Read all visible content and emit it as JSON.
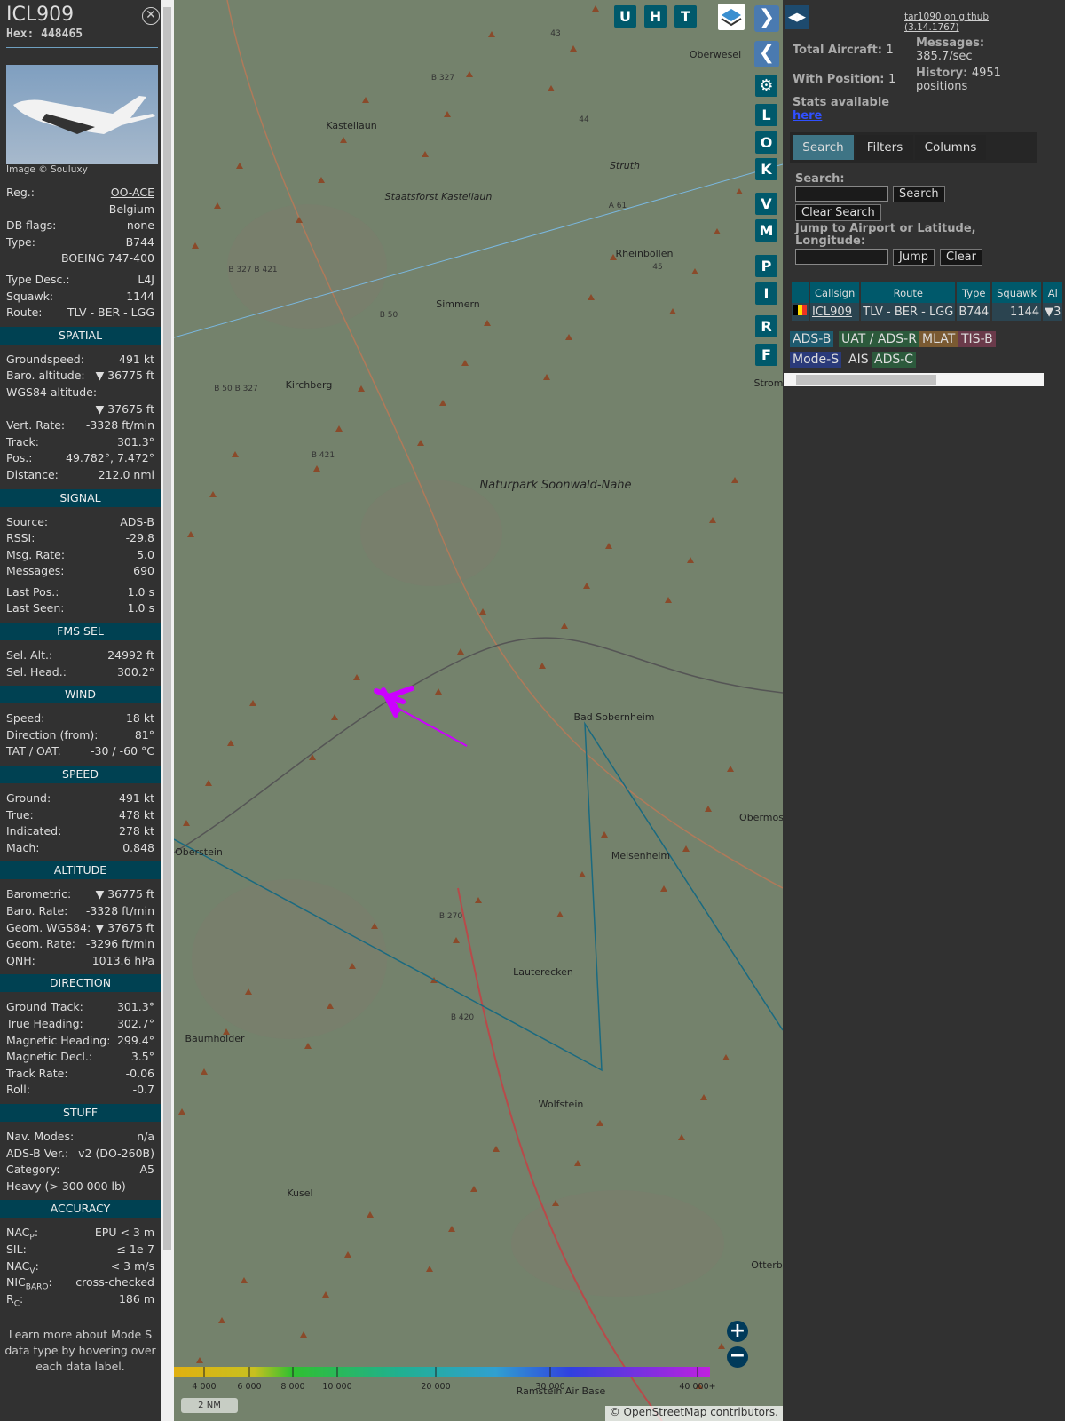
{
  "aircraft": {
    "callsign": "ICL909",
    "hex_label": "Hex:",
    "hex": "448465",
    "photo_credit": "Image © Souluxy"
  },
  "rows": [
    {
      "l": "Reg.:",
      "v": "OO-ACE",
      "link": true
    },
    {
      "l": "",
      "v": "Belgium"
    },
    {
      "l": "DB flags:",
      "v": "none"
    },
    {
      "l": "Type:",
      "v": "B744"
    },
    {
      "l": "",
      "v": "BOEING 747-400"
    },
    {
      "gap": true
    },
    {
      "l": "Type Desc.:",
      "v": "L4J"
    },
    {
      "l": "Squawk:",
      "v": "1144"
    },
    {
      "l": "Route:",
      "v": "TLV - BER - LGG"
    },
    {
      "sec": "SPATIAL"
    },
    {
      "l": "Groundspeed:",
      "v": "491 kt"
    },
    {
      "l": "Baro. altitude:",
      "v": "▼ 36775 ft"
    },
    {
      "l": "WGS84 altitude:",
      "v": ""
    },
    {
      "l": "",
      "v": "▼ 37675 ft"
    },
    {
      "l": "Vert. Rate:",
      "v": "-3328 ft/min"
    },
    {
      "l": "Track:",
      "v": "301.3°"
    },
    {
      "l": "Pos.:",
      "v": "49.782°, 7.472°"
    },
    {
      "l": "Distance:",
      "v": "212.0 nmi"
    },
    {
      "sec": "SIGNAL"
    },
    {
      "l": "Source:",
      "v": "ADS-B"
    },
    {
      "l": "RSSI:",
      "v": "-29.8"
    },
    {
      "l": "Msg. Rate:",
      "v": "5.0"
    },
    {
      "l": "Messages:",
      "v": "690"
    },
    {
      "gap": true
    },
    {
      "l": "Last Pos.:",
      "v": "1.0 s"
    },
    {
      "l": "Last Seen:",
      "v": "1.0 s"
    },
    {
      "sec": "FMS SEL"
    },
    {
      "l": "Sel. Alt.:",
      "v": "24992 ft"
    },
    {
      "l": "Sel. Head.:",
      "v": "300.2°"
    },
    {
      "sec": "WIND"
    },
    {
      "l": "Speed:",
      "v": "18 kt"
    },
    {
      "l": "Direction (from):",
      "v": "81°"
    },
    {
      "l": "TAT / OAT:",
      "v": "-30 / -60 °C"
    },
    {
      "sec": "SPEED"
    },
    {
      "l": "Ground:",
      "v": "491 kt"
    },
    {
      "l": "True:",
      "v": "478 kt"
    },
    {
      "l": "Indicated:",
      "v": "278 kt"
    },
    {
      "l": "Mach:",
      "v": "0.848"
    },
    {
      "sec": "ALTITUDE"
    },
    {
      "l": "Barometric:",
      "v": "▼ 36775 ft"
    },
    {
      "l": "Baro. Rate:",
      "v": "-3328 ft/min"
    },
    {
      "l": "Geom. WGS84:",
      "v": "▼ 37675 ft"
    },
    {
      "l": "Geom. Rate:",
      "v": "-3296 ft/min"
    },
    {
      "l": "QNH:",
      "v": "1013.6 hPa"
    },
    {
      "sec": "DIRECTION"
    },
    {
      "l": "Ground Track:",
      "v": "301.3°"
    },
    {
      "l": "True Heading:",
      "v": "302.7°"
    },
    {
      "l": "Magnetic Heading:",
      "v": "299.4°"
    },
    {
      "l": "Magnetic Decl.:",
      "v": "3.5°"
    },
    {
      "l": "Track Rate:",
      "v": "-0.06"
    },
    {
      "l": "Roll:",
      "v": "-0.7"
    },
    {
      "sec": "STUFF"
    },
    {
      "l": "Nav. Modes:",
      "v": "n/a"
    },
    {
      "l": "ADS-B Ver.:",
      "v": "v2 (DO-260B)"
    },
    {
      "l": "Category:",
      "v": "A5"
    },
    {
      "l": "Heavy (> 300 000 lb)",
      "v": ""
    },
    {
      "sec": "ACCURACY"
    },
    {
      "l": "NAC",
      "sub": "P",
      "v": "EPU < 3 m"
    },
    {
      "l": "SIL:",
      "v": "≤ 1e-7"
    },
    {
      "l": "NAC",
      "sub": "V",
      "v": "< 3 m/s"
    },
    {
      "l": "NIC",
      "sub": "BARO",
      "v": "cross-checked"
    },
    {
      "l": "R",
      "sub": "C",
      "v": "186 m"
    }
  ],
  "note": "Learn more about Mode S data type by hovering over each data label.",
  "map": {
    "buttons_top": [
      "U",
      "H",
      "T"
    ],
    "buttons_side": [
      "L",
      "O",
      "K",
      "V",
      "M",
      "P",
      "I",
      "R",
      "F"
    ],
    "places": [
      "Oberwesel",
      "Kastellaun",
      "Staatsforst Kastellaun",
      "Struth",
      "Rheinböllen",
      "Simmern",
      "Kirchberg",
      "Naturpark Soonwald-Nahe",
      "Bad Sobernheim",
      "Oberstein",
      "Meisenheim",
      "Lauterecken",
      "Baumholder",
      "Wolfstein",
      "Kusel",
      "Ramstein Air Base",
      "Obermos",
      "Otterb",
      "Strom",
      "Ba"
    ],
    "roads": [
      "B 327",
      "B 327\nB 421",
      "B 50",
      "B 50\nB 327",
      "B 421",
      "B 270",
      "B 420",
      "A 61",
      "43",
      "44",
      "45"
    ],
    "legend_ticks": [
      "4 000",
      "6 000",
      "8 000",
      "10 000",
      "20 000",
      "30 000",
      "40 000+"
    ],
    "scale": "2 NM",
    "attribution_prefix": "© ",
    "attribution_link": "OpenStreetMap",
    "attribution_suffix": " contributors.",
    "track_color": "#cc00ff",
    "range_color": "#1a6a80"
  },
  "right": {
    "github": "tar1090 on github (3.14.1767)",
    "total_label": "Total Aircraft:",
    "total": "1",
    "withpos_label": "With Position:",
    "withpos": "1",
    "messages_label": "Messages:",
    "messages": "385.7/sec",
    "history_label": "History:",
    "history": "4951",
    "history_unit": "positions",
    "stats_label": "Stats available",
    "stats_link": "here",
    "tabs": [
      "Search",
      "Filters",
      "Columns"
    ],
    "search_label": "Search:",
    "search_btn": "Search",
    "clear_search_btn": "Clear Search",
    "jump_label": "Jump to Airport or Latitude, Longitude:",
    "jump_btn": "Jump",
    "clear_btn": "Clear",
    "table_headers": [
      "",
      "Callsign",
      "Route",
      "Type",
      "Squawk",
      "Al"
    ],
    "table_row": {
      "callsign": "ICL909",
      "route": "TLV - BER - LGG",
      "type": "B744",
      "squawk": "1144",
      "alt": "▼3"
    },
    "badges": [
      {
        "t": "ADS-B",
        "c": "#1d5a6e"
      },
      {
        "t": "UAT / ADS-R",
        "c": "#2c5a3c"
      },
      {
        "t": "MLAT",
        "c": "#7a5a32"
      },
      {
        "t": "TIS-B",
        "c": "#6a3a4a"
      },
      {
        "t": "Mode-S",
        "c": "#2a3a7a"
      },
      {
        "t": "AIS",
        "c": "#313131"
      },
      {
        "t": "ADS-C",
        "c": "#2c5a3c"
      }
    ]
  }
}
